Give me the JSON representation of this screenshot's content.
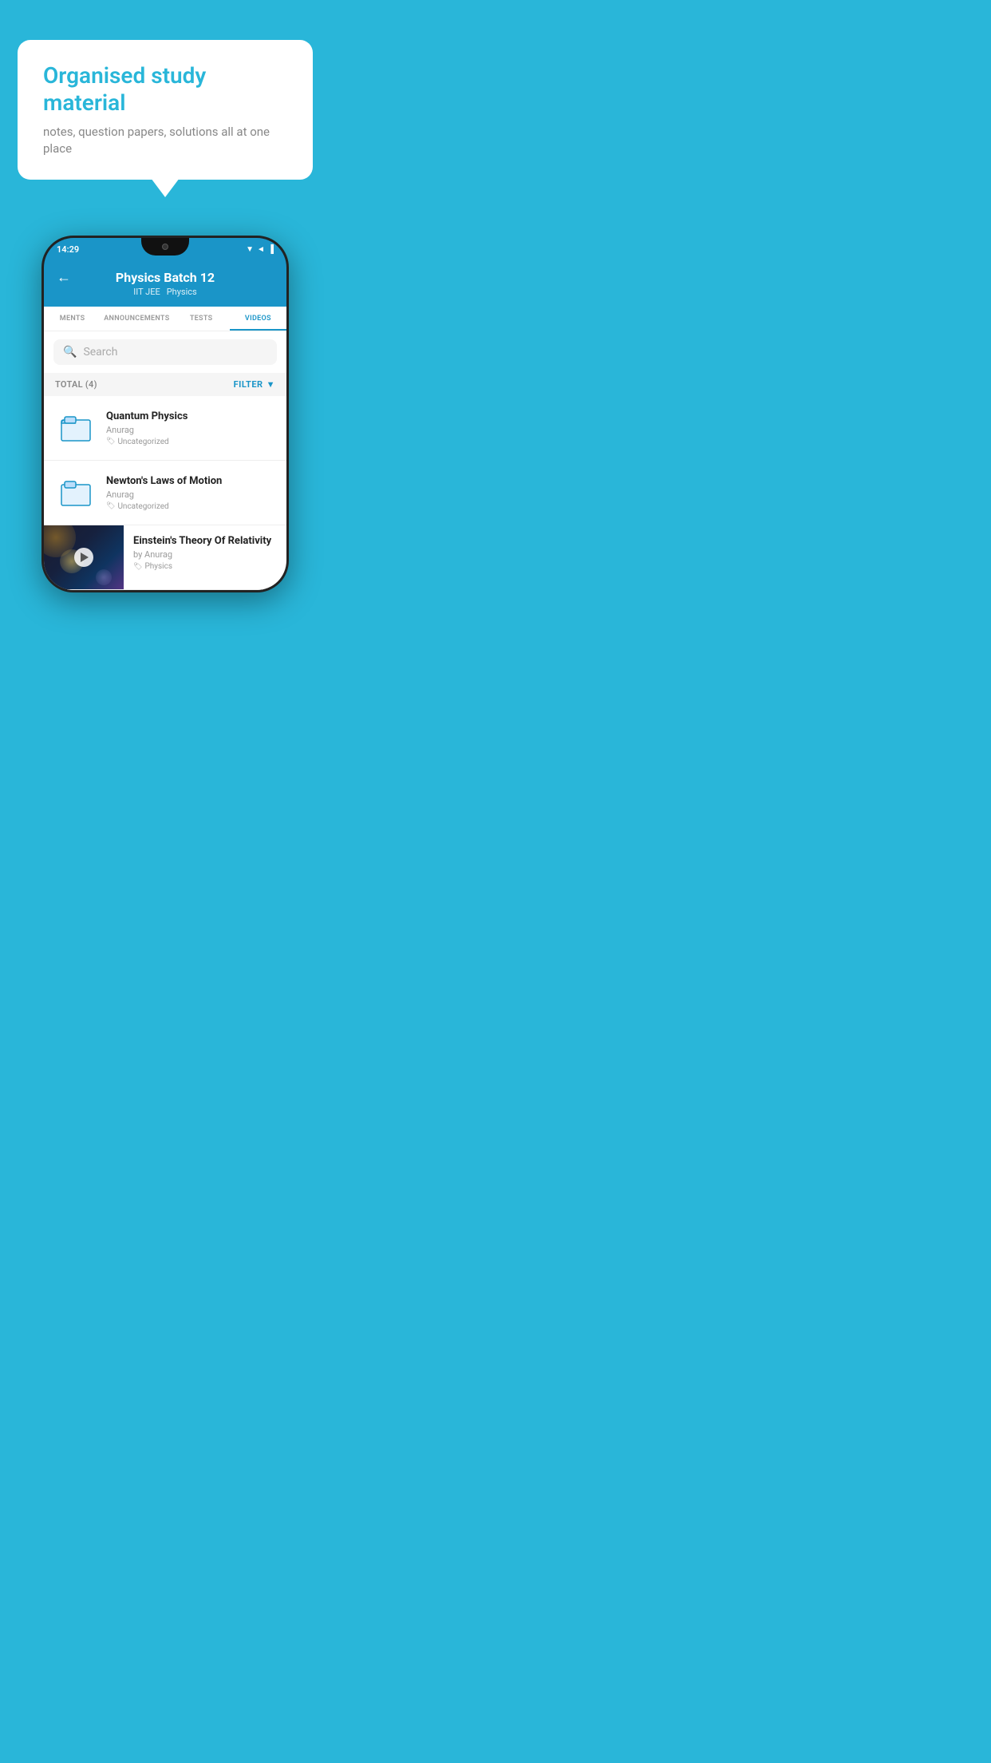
{
  "background_color": "#29B6D9",
  "speech_bubble": {
    "title": "Organised study material",
    "subtitle": "notes, question papers, solutions all at one place"
  },
  "phone": {
    "status_bar": {
      "time": "14:29",
      "icons": "▼◄▐"
    },
    "header": {
      "title": "Physics Batch 12",
      "subtitle_part1": "IIT JEE",
      "subtitle_part2": "Physics",
      "back_label": "←"
    },
    "tabs": [
      {
        "label": "MENTS",
        "active": false
      },
      {
        "label": "ANNOUNCEMENTS",
        "active": false
      },
      {
        "label": "TESTS",
        "active": false
      },
      {
        "label": "VIDEOS",
        "active": true
      }
    ],
    "search": {
      "placeholder": "Search"
    },
    "filter": {
      "total_label": "TOTAL (4)",
      "filter_label": "FILTER"
    },
    "videos": [
      {
        "id": 1,
        "title": "Quantum Physics",
        "author": "Anurag",
        "tag": "Uncategorized",
        "type": "folder"
      },
      {
        "id": 2,
        "title": "Newton's Laws of Motion",
        "author": "Anurag",
        "tag": "Uncategorized",
        "type": "folder"
      },
      {
        "id": 3,
        "title": "Einstein's Theory Of Relativity",
        "author": "by Anurag",
        "tag": "Physics",
        "type": "video"
      }
    ]
  }
}
